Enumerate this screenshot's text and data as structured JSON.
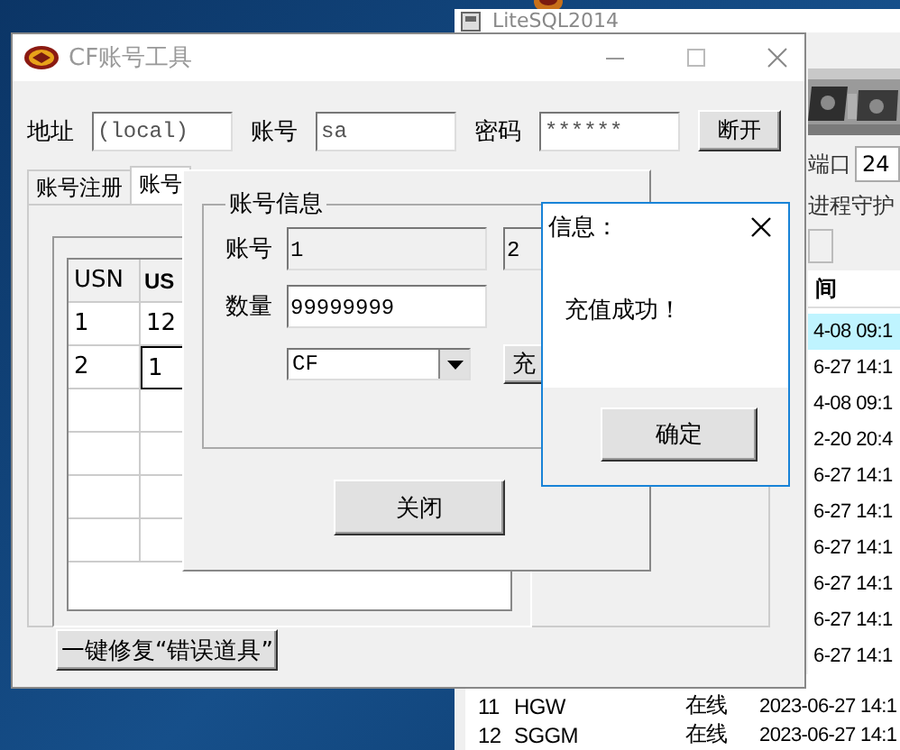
{
  "background_window": {
    "title": "LiteSQL2014",
    "port_label": "端口",
    "port_value": "24",
    "daemon_label": "进程守护",
    "time_header": "间",
    "rows": [
      {
        "kind": "partial",
        "time": "4-08 09:1",
        "selected": true
      },
      {
        "kind": "partial",
        "time": "6-27 14:1",
        "selected": false
      },
      {
        "kind": "partial",
        "time": "4-08 09:1",
        "selected": false
      },
      {
        "kind": "partial",
        "time": "2-20 20:4",
        "selected": false
      },
      {
        "kind": "partial",
        "time": "6-27 14:1",
        "selected": false
      },
      {
        "kind": "partial",
        "time": "6-27 14:1",
        "selected": false
      },
      {
        "kind": "partial",
        "time": "6-27 14:1",
        "selected": false
      },
      {
        "kind": "partial",
        "time": "6-27 14:1",
        "selected": false
      },
      {
        "kind": "partial",
        "time": "6-27 14:1",
        "selected": false
      },
      {
        "kind": "partial",
        "time": "6-27 14:1",
        "selected": false
      },
      {
        "kind": "full",
        "number": "11",
        "name": "HGW",
        "status": "在线",
        "time": "2023-06-27 14:1",
        "selected": false
      },
      {
        "kind": "full",
        "number": "12",
        "name": "SGGM",
        "status": "在线",
        "time": "2023-06-27 14:1",
        "selected": false
      }
    ]
  },
  "main_window": {
    "title": "CF账号工具",
    "connection": {
      "fields": [
        {
          "label": "地址",
          "value": "(local)"
        },
        {
          "label": "账号",
          "value": "sa"
        },
        {
          "label": "密码",
          "value": "******"
        }
      ],
      "button": "断开"
    },
    "tabs": [
      {
        "label": "账号注册",
        "selected": false
      },
      {
        "label": "账号",
        "selected": true
      }
    ],
    "grid": {
      "columns": [
        {
          "label": "USN",
          "bold": false
        },
        {
          "label": "US",
          "bold": true
        }
      ],
      "rows": [
        [
          {
            "text": "1",
            "focused": false
          },
          {
            "text": "12",
            "focused": false
          }
        ],
        [
          {
            "text": "2",
            "focused": false
          },
          {
            "text": "1",
            "focused": true
          }
        ]
      ]
    },
    "repair_button": "一键修复“错误道具”"
  },
  "recharge_window": {
    "group_title": "账号信息",
    "account_label": "账号",
    "account_value": "1",
    "account_value_2": "2",
    "amount_label": "数量",
    "amount_value": "99999999",
    "game_select": "CF",
    "recharge_button": "充",
    "close_button": "关闭"
  },
  "message_box": {
    "title": "信息：",
    "message": "充值成功！",
    "ok_button": "确定"
  }
}
